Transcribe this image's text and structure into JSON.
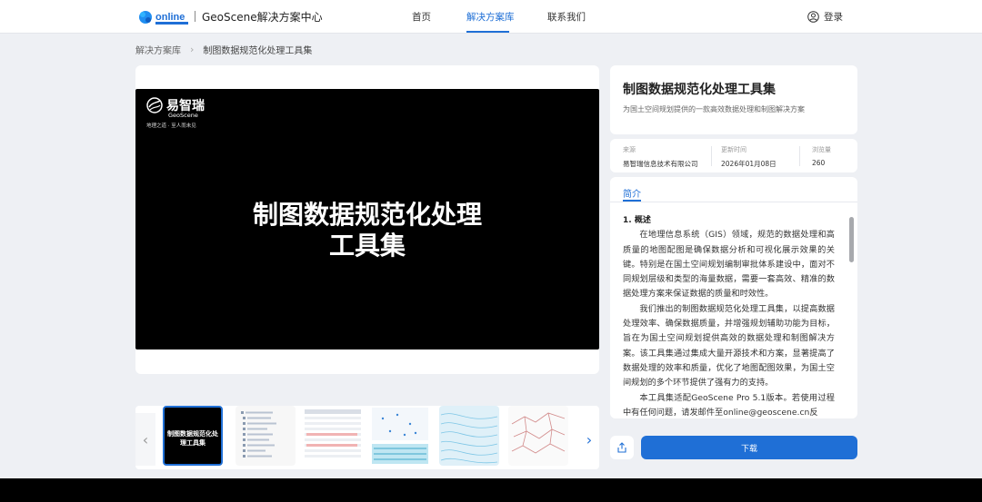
{
  "header": {
    "logo_text": "online",
    "site_title": "GeoScene解决方案中心",
    "nav": [
      {
        "label": "首页"
      },
      {
        "label": "解决方案库"
      },
      {
        "label": "联系我们"
      }
    ],
    "active_nav": "解决方案库",
    "login_label": "登录"
  },
  "breadcrumb": {
    "root": "解决方案库",
    "current": "制图数据规范化处理工具集"
  },
  "preview": {
    "brand_name": "易智瑞",
    "brand_sub": "GeoScene",
    "brand_tagline": "地理之道 · 至人而未见",
    "title_line1": "制图数据规范化处理",
    "title_line2": "工具集"
  },
  "thumbnails": {
    "selected_title": "制图数据规范化处理工具集",
    "count": 6
  },
  "info": {
    "title": "制图数据规范化处理工具集",
    "subtitle": "为国土空间规划提供的一款高效数据处理和制图解决方案"
  },
  "meta": {
    "source_label": "来源",
    "source_value": "易智瑞信息技术有限公司",
    "updated_label": "更新时间",
    "updated_value": "2026年01月08日",
    "views_label": "浏览量",
    "views_value": "260"
  },
  "description": {
    "tab_label": "简介",
    "heading": "1. 概述",
    "paragraphs": [
      "在地理信息系统（GIS）领域，规范的数据处理和高质量的地图配图是确保数据分析和可视化展示效果的关键。特别是在国土空间规划编制审批体系建设中，面对不同规划层级和类型的海量数据，需要一套高效、精准的数据处理方案来保证数据的质量和时效性。",
      "我们推出的制图数据规范化处理工具集，以提高数据处理效率、确保数据质量，并增强规划辅助功能为目标，旨在为国土空间规划提供高效的数据处理和制图解决方案。该工具集通过集成大量开源技术和方案，显著提高了数据处理的效率和质量，优化了地图配图效果，为国土空间规划的多个环节提供了强有力的支持。",
      "本工具集适配GeoScene Pro 5.1版本。若使用过程中有任何问题，请发邮件至online@geoscene.cn反"
    ]
  },
  "actions": {
    "download_label": "下载"
  },
  "colors": {
    "accent": "#1f6fd6",
    "background": "#eef0f4"
  }
}
